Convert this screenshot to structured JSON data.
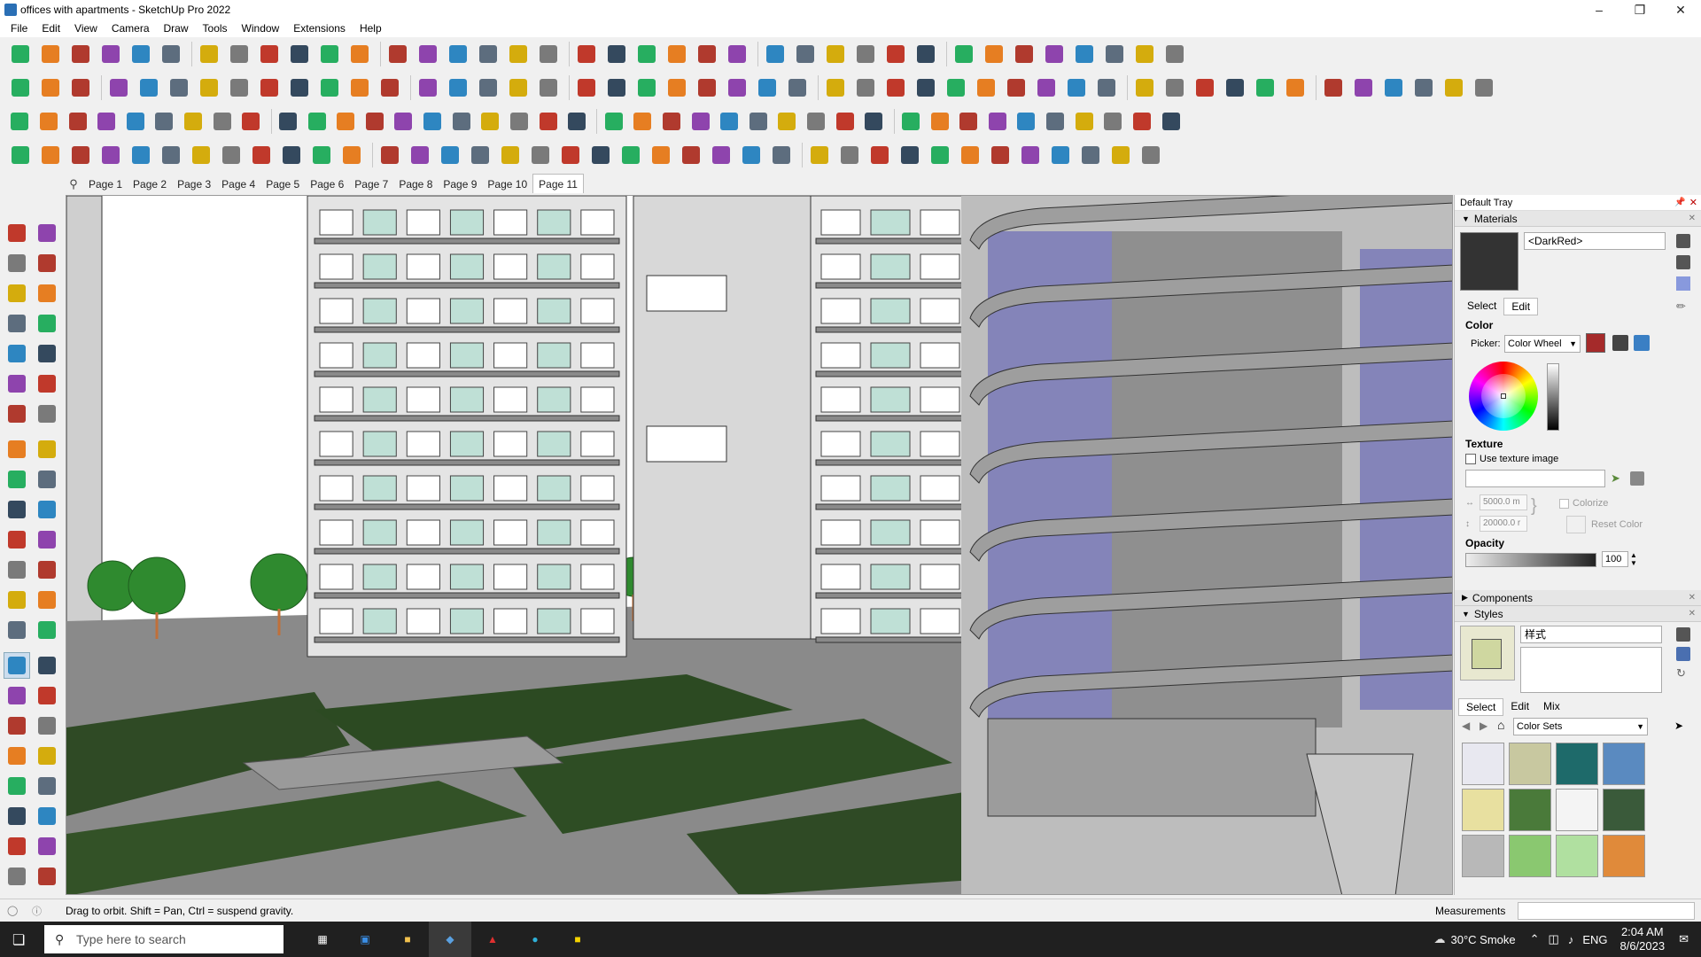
{
  "window": {
    "title": "offices with apartments - SketchUp Pro 2022",
    "controls": [
      "minimize",
      "restore",
      "close"
    ]
  },
  "menu": [
    "File",
    "Edit",
    "View",
    "Camera",
    "Draw",
    "Tools",
    "Window",
    "Extensions",
    "Help"
  ],
  "scenes": {
    "tabs": [
      "Page 1",
      "Page 2",
      "Page 3",
      "Page 4",
      "Page 5",
      "Page 6",
      "Page 7",
      "Page 8",
      "Page 9",
      "Page 10",
      "Page 11"
    ],
    "active": "Page 11"
  },
  "tray": {
    "title": "Default Tray",
    "materials": {
      "header": "Materials",
      "name": "<DarkRed>",
      "tabs": [
        "Select",
        "Edit"
      ],
      "active_tab": "Edit",
      "color_label": "Color",
      "picker_label": "Picker:",
      "picker_value": "Color Wheel",
      "swatch_color": "#a52a2a",
      "texture_label": "Texture",
      "use_texture": "Use texture image",
      "width": "5000.0 m",
      "height": "20000.0 r",
      "colorize": "Colorize",
      "reset_color": "Reset Color",
      "opacity_label": "Opacity",
      "opacity_value": "100"
    },
    "components": {
      "header": "Components"
    },
    "styles": {
      "header": "Styles",
      "name": "样式",
      "tabs": [
        "Select",
        "Edit",
        "Mix"
      ],
      "active_tab": "Select",
      "collection": "Color Sets"
    }
  },
  "status": {
    "message": "Drag to orbit. Shift = Pan, Ctrl = suspend gravity.",
    "measurements_label": "Measurements"
  },
  "taskbar": {
    "search_placeholder": "Type here to search",
    "weather": "30°C  Smoke",
    "language": "ENG",
    "time": "2:04 AM",
    "date": "8/6/2023"
  }
}
